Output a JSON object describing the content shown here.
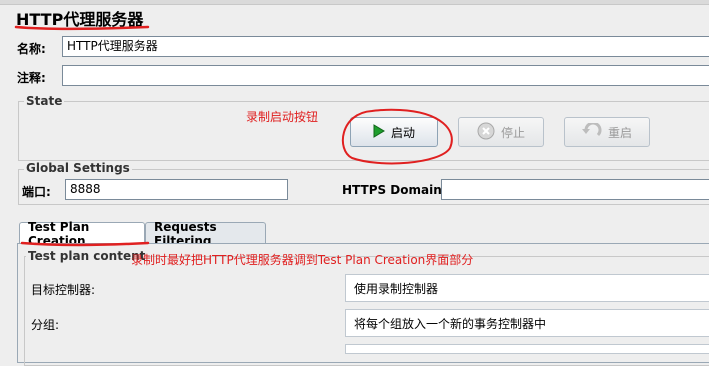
{
  "title": "HTTP代理服务器",
  "form": {
    "name_label": "名称:",
    "name_value": "HTTP代理服务器",
    "comment_label": "注释:",
    "comment_value": ""
  },
  "state": {
    "group_title": "State",
    "annotation": "录制启动按钮",
    "start_label": "启动",
    "stop_label": "停止",
    "restart_label": "重启"
  },
  "global_settings": {
    "group_title": "Global Settings",
    "port_label": "端口:",
    "port_value": "8888",
    "https_label": "HTTPS Domains:",
    "https_value": ""
  },
  "tabs": [
    {
      "label": "Test Plan Creation",
      "active": true
    },
    {
      "label": "Requests Filtering",
      "active": false
    }
  ],
  "test_plan": {
    "group_title": "Test plan content",
    "annotation": "录制时最好把HTTP代理服务器调到Test Plan Creation界面部分",
    "target_controller_label": "目标控制器:",
    "target_controller_value": "使用录制控制器",
    "grouping_label": "分组:",
    "grouping_value": "将每个组放入一个新的事务控制器中"
  },
  "colors": {
    "annotation_red": "#e02020",
    "start_icon_green": "#1e9e2c"
  },
  "icons": {
    "start": "play-icon",
    "stop": "stop-circle-icon",
    "restart": "restart-arrow-icon"
  }
}
